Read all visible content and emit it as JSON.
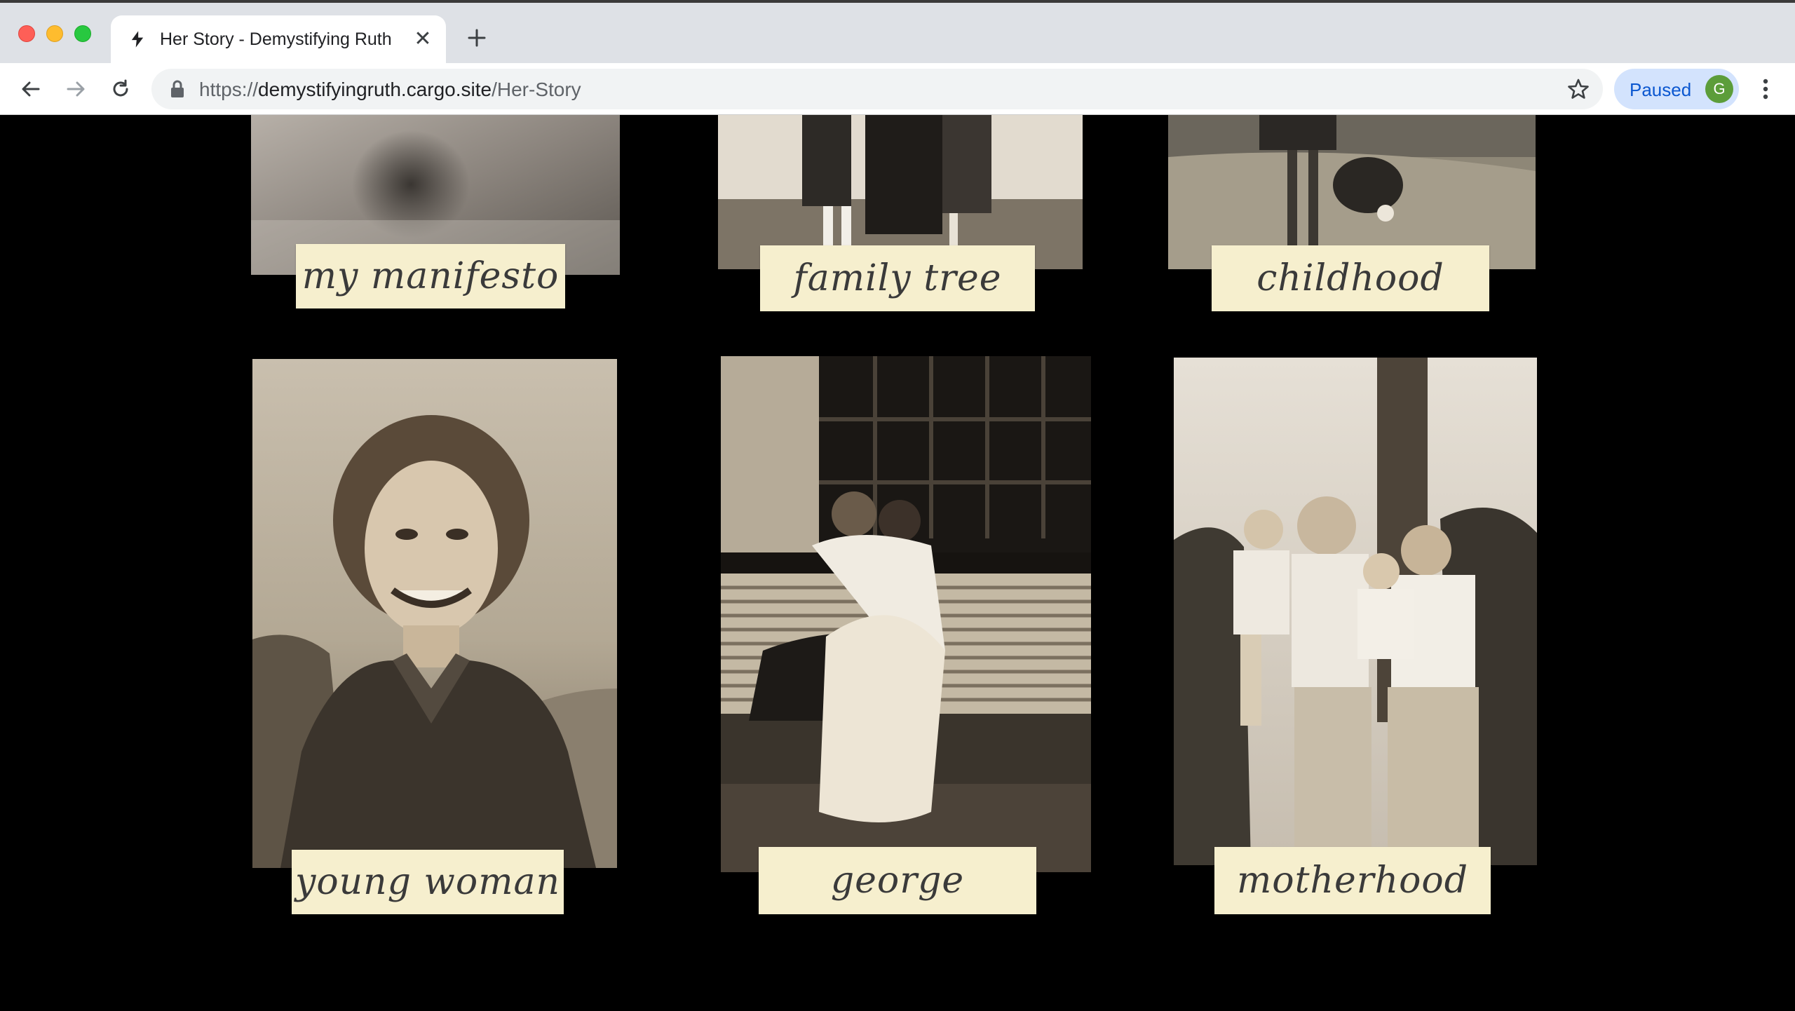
{
  "browser": {
    "tab": {
      "title": "Her Story - Demystifying Ruth",
      "close_glyph": "✕",
      "icon": "bolt-icon"
    },
    "new_tab_icon": "plus-icon",
    "nav": {
      "back_icon": "arrow-left-icon",
      "forward_icon": "arrow-right-icon",
      "reload_icon": "reload-icon"
    },
    "address": {
      "scheme": "https://",
      "host": "demystifyingruth.cargo.site",
      "path": "/Her-Story",
      "lock_icon": "lock-icon",
      "bookmark_icon": "star-icon"
    },
    "profile": {
      "label": "Paused",
      "avatar_letter": "G",
      "avatar_color": "#5c9d3a"
    },
    "menu_icon": "kebab-menu-icon"
  },
  "gallery": {
    "items": [
      {
        "label": "my manifesto"
      },
      {
        "label": "family tree"
      },
      {
        "label": "childhood"
      },
      {
        "label": "young woman"
      },
      {
        "label": "george"
      },
      {
        "label": "motherhood"
      }
    ]
  },
  "colors": {
    "page_bg": "#000000",
    "label_paper": "#f6efce",
    "sepia": "#8a7b66"
  }
}
